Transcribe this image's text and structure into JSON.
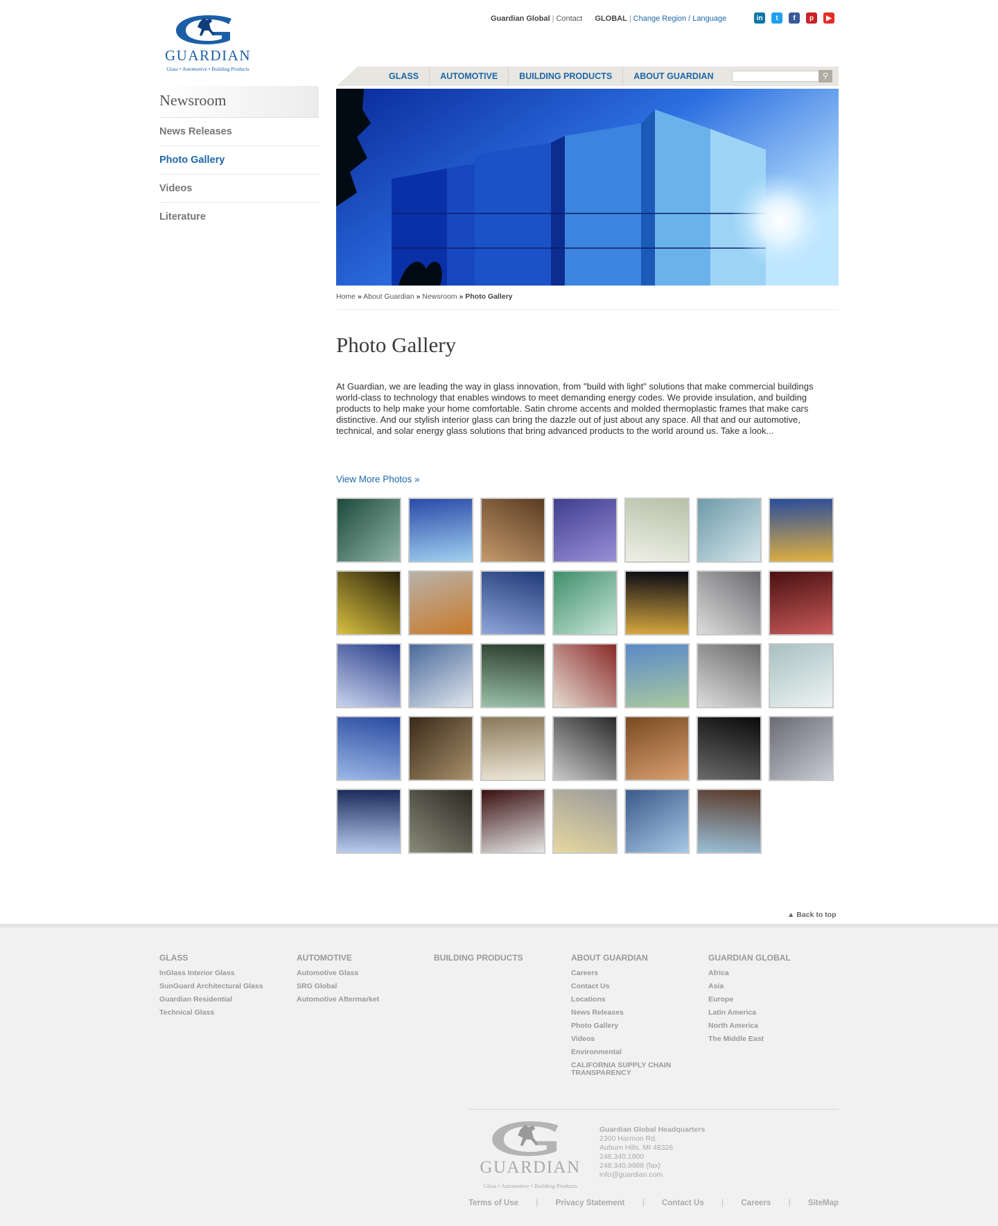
{
  "header": {
    "logo_text": "GUARDIAN",
    "logo_tagline": "Glass • Automotive • Building Products",
    "top_links": {
      "global": "Guardian Global",
      "contact": "Contact",
      "region_label": "GLOBAL",
      "change_region": "Change Region / Language"
    },
    "social": [
      {
        "name": "linkedin-icon",
        "glyph": "in",
        "color": "#0e76a8"
      },
      {
        "name": "twitter-icon",
        "glyph": "t",
        "color": "#1da1f2"
      },
      {
        "name": "facebook-icon",
        "glyph": "f",
        "color": "#3b5998"
      },
      {
        "name": "pinterest-icon",
        "glyph": "p",
        "color": "#cb2027"
      },
      {
        "name": "youtube-icon",
        "glyph": "▶",
        "color": "#e52d27"
      }
    ],
    "nav": [
      "GLASS",
      "AUTOMOTIVE",
      "BUILDING PRODUCTS",
      "ABOUT GUARDIAN"
    ],
    "search_placeholder": ""
  },
  "sidebar": {
    "title": "Newsroom",
    "items": [
      {
        "label": "News Releases",
        "active": false
      },
      {
        "label": "Photo Gallery",
        "active": true
      },
      {
        "label": "Videos",
        "active": false
      },
      {
        "label": "Literature",
        "active": false
      }
    ]
  },
  "breadcrumb": {
    "home": "Home",
    "about": "About Guardian",
    "newsroom": "Newsroom",
    "current": "Photo Gallery",
    "sep": "»"
  },
  "main": {
    "title": "Photo Gallery",
    "intro": "At Guardian, we are leading the way in glass innovation, from \"build with light\" solutions that make commercial buildings world-class to technology that enables windows to meet demanding energy codes. We provide insulation, and building products to help make your home comfortable. Satin chrome accents and molded thermoplastic frames that make cars distinctive.  And our stylish interior glass can bring the dazzle out of just about any space.  All that and our automotive, technical, and solar energy glass solutions that bring advanced products to the world around us. Take a look...",
    "view_more": "View More Photos »"
  },
  "gallery": [
    [
      "#1c4a3c",
      "#8fb4a8"
    ],
    [
      "#2b4aa8",
      "#9fd0f0"
    ],
    [
      "#5a3b22",
      "#c49a6c"
    ],
    [
      "#3f3f8e",
      "#9a8fd8"
    ],
    [
      "#b7c0a8",
      "#eef0e6"
    ],
    [
      "#6c9aa8",
      "#d7e7ec"
    ],
    [
      "#2a4d9c",
      "#e0b040"
    ],
    [
      "#2a220a",
      "#d8c040"
    ],
    [
      "#b8b2aa",
      "#c97a2a"
    ],
    [
      "#1f3a7a",
      "#8fa6d8"
    ],
    [
      "#3f8f6a",
      "#c8e6d8"
    ],
    [
      "#0a0a14",
      "#d8a840"
    ],
    [
      "#6a6a6e",
      "#dcdcdc"
    ],
    [
      "#4a1010",
      "#c85a5a"
    ],
    [
      "#2a3e8a",
      "#c8d4ee"
    ],
    [
      "#4a6a9a",
      "#e0e6ee"
    ],
    [
      "#2a3a2a",
      "#9ac2a8"
    ],
    [
      "#8a2a2a",
      "#e6dcd0"
    ],
    [
      "#5a8ac8",
      "#a8c8a0"
    ],
    [
      "#6a6a6a",
      "#dcdcdc"
    ],
    [
      "#a8c0c0",
      "#eef4f4"
    ],
    [
      "#2a4aa0",
      "#9ab8e6"
    ],
    [
      "#3a2a1a",
      "#a8906a"
    ],
    [
      "#8a7a5a",
      "#eee6d6"
    ],
    [
      "#2a2a2a",
      "#c8c8c8"
    ],
    [
      "#7a4a22",
      "#d8a070"
    ],
    [
      "#0a0a0a",
      "#6a6a6a"
    ],
    [
      "#6a6a72",
      "#c8ccd6"
    ],
    [
      "#1a2a5a",
      "#b8ccee"
    ],
    [
      "#2a2a22",
      "#8a8a7a"
    ],
    [
      "#3a1010",
      "#e6e6e6"
    ],
    [
      "#9a9a9a",
      "#e6d8a0"
    ],
    [
      "#3a5a8a",
      "#a8c8e6"
    ],
    [
      "#5a3a2a",
      "#9ac0d8"
    ]
  ],
  "back_to_top": "▲ Back to top",
  "footer": {
    "columns": [
      {
        "heading": "GLASS",
        "links": [
          "InGlass Interior Glass",
          "SunGuard Architectural Glass",
          "Guardian Residential",
          "Technical Glass"
        ]
      },
      {
        "heading": "AUTOMOTIVE",
        "links": [
          "Automotive Glass",
          "SRG Global",
          "Automotive Aftermarket"
        ]
      },
      {
        "heading": "BUILDING PRODUCTS",
        "links": []
      },
      {
        "heading": "ABOUT GUARDIAN",
        "links": [
          "Careers",
          "Contact Us",
          "Locations",
          "News Releases",
          "Photo Gallery",
          "Videos",
          "Environmental",
          "CALIFORNIA SUPPLY CHAIN TRANSPARENCY"
        ]
      },
      {
        "heading": "GUARDIAN GLOBAL",
        "links": [
          "Africa",
          "Asia",
          "Europe",
          "Latin America",
          "North America",
          "The Middle East"
        ]
      }
    ],
    "logo_text": "GUARDIAN",
    "logo_tagline": "Glass • Automotive • Building Products",
    "address": {
      "heading": "Guardian Global Headquarters",
      "street": "2300 Harmon Rd.",
      "city": "Auburn Hills, MI  48326",
      "phone": "248.340.1800",
      "fax": "248.340.9988 (fax)",
      "email": "info@guardian.com"
    },
    "bottom_links": [
      "Terms of Use",
      "Privacy Statement",
      "Contact Us",
      "Careers",
      "SiteMap"
    ]
  }
}
